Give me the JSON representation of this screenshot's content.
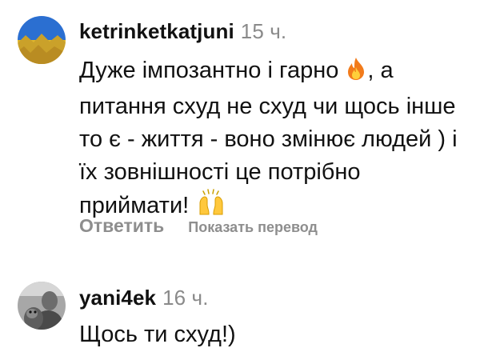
{
  "comments": [
    {
      "username": "ketrinketkatjuni",
      "time": "15 ч.",
      "text_line1": "Дуже імпозантно і гарно",
      "text_line1_after": ", а",
      "text_rest": "питання схуд не схуд чи щось інше то є - життя - воно змінює людей ) і їх зовнішності це потрібно приймати!",
      "emoji_1": "fire-icon",
      "emoji_2": "raising-hands-icon",
      "reply_label": "Ответить",
      "translate_label": "Показать перевод"
    },
    {
      "username": "yani4ek",
      "time": "16 ч.",
      "text": "Щось ти схуд!)"
    }
  ]
}
